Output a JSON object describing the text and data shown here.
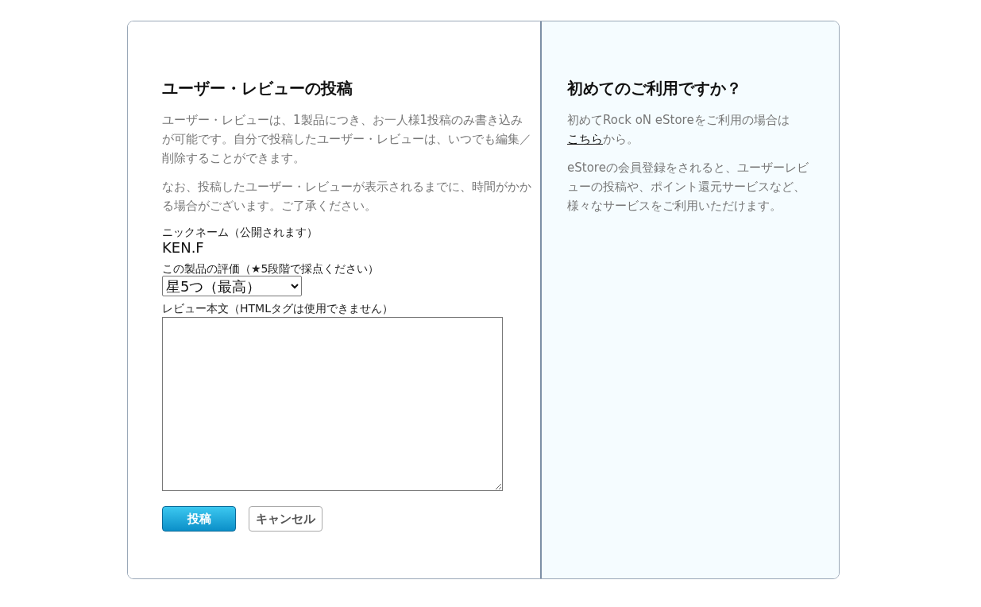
{
  "review_form": {
    "title": "ユーザー・レビューの投稿",
    "paragraphs": [
      "ユーザー・レビューは、1製品につき、お一人様1投稿のみ書き込みが可能です。自分で投稿したユーザー・レビューは、いつでも編集／削除することができます。",
      "なお、投稿したユーザー・レビューが表示されるまでに、時間がかかる場合がございます。ご了承ください。"
    ],
    "nickname_label": "ニックネーム（公開されます）",
    "nickname": "KEN.F",
    "rating_label": "この製品の評価（★5段階で採点ください）",
    "rating_value": "星5つ（最高）",
    "body_label": "レビュー本文（HTMLタグは使用できません）",
    "buttons": [
      {
        "label": "投稿",
        "kind": "primary"
      },
      {
        "label": "キャンセル",
        "kind": "secondary"
      }
    ]
  },
  "first_time": {
    "title": "初めてのご利用ですか？",
    "intro_before": "初めてRock oN eStoreをご利用の場合は",
    "intro_link": "こちら",
    "intro_after": "から。",
    "paragraph": "eStoreの会員登録をされると、ユーザーレビューの投稿や、ポイント還元サービスなど、様々なサービスをご利用いただけます。"
  }
}
